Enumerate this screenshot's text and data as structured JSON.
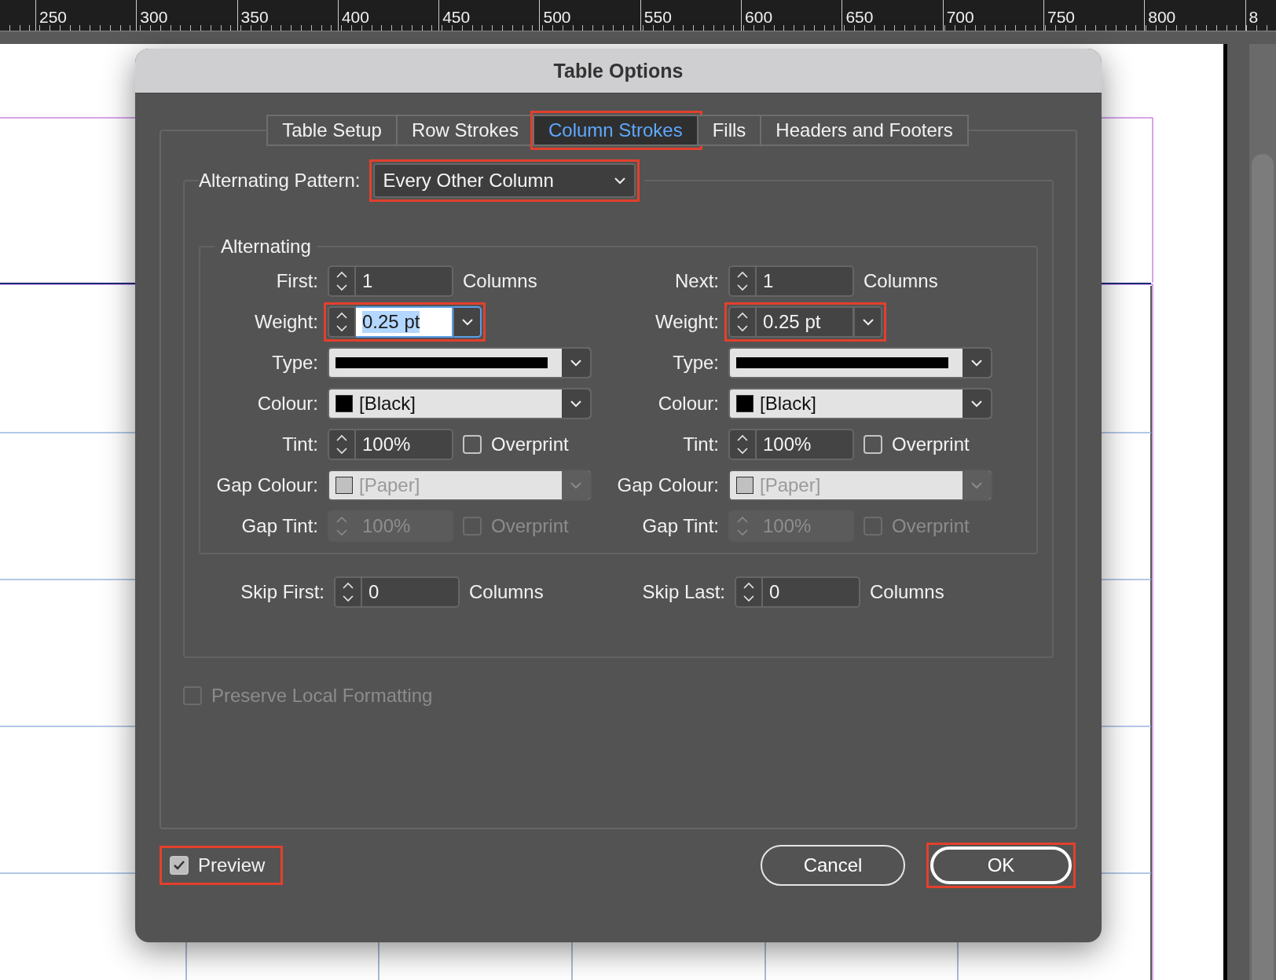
{
  "ruler": {
    "labels": [
      "250",
      "300",
      "350",
      "400",
      "450",
      "500",
      "550",
      "600",
      "650",
      "700",
      "750",
      "800",
      "8"
    ]
  },
  "dialog": {
    "title": "Table Options",
    "tabs": [
      {
        "label": "Table Setup",
        "selected": false,
        "highlighted": false
      },
      {
        "label": "Row Strokes",
        "selected": false,
        "highlighted": false
      },
      {
        "label": "Column Strokes",
        "selected": true,
        "highlighted": true
      },
      {
        "label": "Fills",
        "selected": false,
        "highlighted": false
      },
      {
        "label": "Headers and Footers",
        "selected": false,
        "highlighted": false
      }
    ],
    "alternating_pattern": {
      "label": "Alternating Pattern:",
      "value": "Every Other Column",
      "highlighted": true
    },
    "alternating": {
      "title": "Alternating",
      "columns": [
        {
          "rows": [
            {
              "kind": "spinner",
              "label": "First:",
              "value": "1",
              "unit": "Columns"
            },
            {
              "kind": "weight",
              "label": "Weight:",
              "value": "0.25 pt",
              "focused": true,
              "highlighted": true
            },
            {
              "kind": "stroke",
              "label": "Type:"
            },
            {
              "kind": "colour",
              "label": "Colour:",
              "value": "[Black]",
              "color": "#000000",
              "disabled": false
            },
            {
              "kind": "tint",
              "label": "Tint:",
              "value": "100%",
              "overprint": "Overprint",
              "checked": false,
              "disabled": false
            },
            {
              "kind": "colour",
              "label": "Gap Colour:",
              "value": "[Paper]",
              "color": "#c0c0c0",
              "disabled": true
            },
            {
              "kind": "tint",
              "label": "Gap Tint:",
              "value": "100%",
              "overprint": "Overprint",
              "checked": false,
              "disabled": true
            }
          ]
        },
        {
          "rows": [
            {
              "kind": "spinner",
              "label": "Next:",
              "value": "1",
              "unit": "Columns"
            },
            {
              "kind": "weight",
              "label": "Weight:",
              "value": "0.25 pt",
              "focused": false,
              "highlighted": true
            },
            {
              "kind": "stroke",
              "label": "Type:"
            },
            {
              "kind": "colour",
              "label": "Colour:",
              "value": "[Black]",
              "color": "#000000",
              "disabled": false
            },
            {
              "kind": "tint",
              "label": "Tint:",
              "value": "100%",
              "overprint": "Overprint",
              "checked": false,
              "disabled": false
            },
            {
              "kind": "colour",
              "label": "Gap Colour:",
              "value": "[Paper]",
              "color": "#c0c0c0",
              "disabled": true
            },
            {
              "kind": "tint",
              "label": "Gap Tint:",
              "value": "100%",
              "overprint": "Overprint",
              "checked": false,
              "disabled": true
            }
          ]
        }
      ]
    },
    "skip": [
      {
        "label": "Skip First:",
        "value": "0",
        "unit": "Columns"
      },
      {
        "label": "Skip Last:",
        "value": "0",
        "unit": "Columns"
      }
    ],
    "preserve": {
      "label": "Preserve Local Formatting",
      "checked": false,
      "disabled": true
    },
    "preview": {
      "label": "Preview",
      "checked": true,
      "highlighted": true
    },
    "buttons": [
      {
        "label": "Cancel",
        "default": false,
        "highlighted": false
      },
      {
        "label": "OK",
        "default": true,
        "highlighted": true
      }
    ]
  }
}
